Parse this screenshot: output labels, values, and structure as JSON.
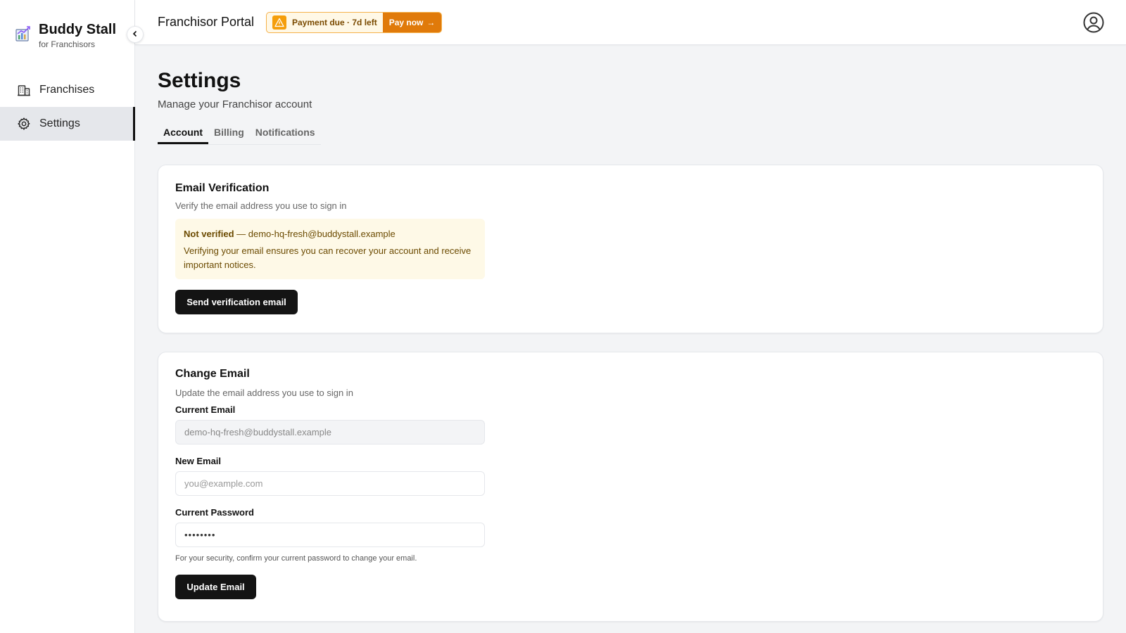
{
  "brand": {
    "title": "Buddy Stall",
    "subtitle": "for Franchisors"
  },
  "sidebar": {
    "items": [
      {
        "label": "Franchises",
        "icon": "building-icon",
        "active": false
      },
      {
        "label": "Settings",
        "icon": "gear-icon",
        "active": true
      }
    ]
  },
  "header": {
    "title": "Franchisor Portal",
    "payment_banner": "Payment due · 7d left",
    "pay_now": "Pay now",
    "pay_arrow": "→"
  },
  "page": {
    "title": "Settings",
    "subtitle": "Manage your Franchisor account",
    "tabs": [
      {
        "label": "Account",
        "active": true
      },
      {
        "label": "Billing",
        "active": false
      },
      {
        "label": "Notifications",
        "active": false
      }
    ]
  },
  "email_verification": {
    "title": "Email Verification",
    "subtitle": "Verify the email address you use to sign in",
    "status_label": "Not verified",
    "status_sep": " — ",
    "email": "demo-hq-fresh@buddystall.example",
    "message": "Verifying your email ensures you can recover your account and receive important notices.",
    "button": "Send verification email"
  },
  "change_email": {
    "title": "Change Email",
    "subtitle": "Update the email address you use to sign in",
    "current_email_label": "Current Email",
    "current_email_value": "demo-hq-fresh@buddystall.example",
    "new_email_label": "New Email",
    "new_email_placeholder": "you@example.com",
    "password_label": "Current Password",
    "password_value": "••••••••",
    "help": "For your security, confirm your current password to change your email.",
    "button": "Update Email"
  },
  "colors": {
    "accent": "#e07a0a",
    "warning_bg": "#fef9e7",
    "dark_button": "#141414",
    "background": "#f3f4f6"
  }
}
